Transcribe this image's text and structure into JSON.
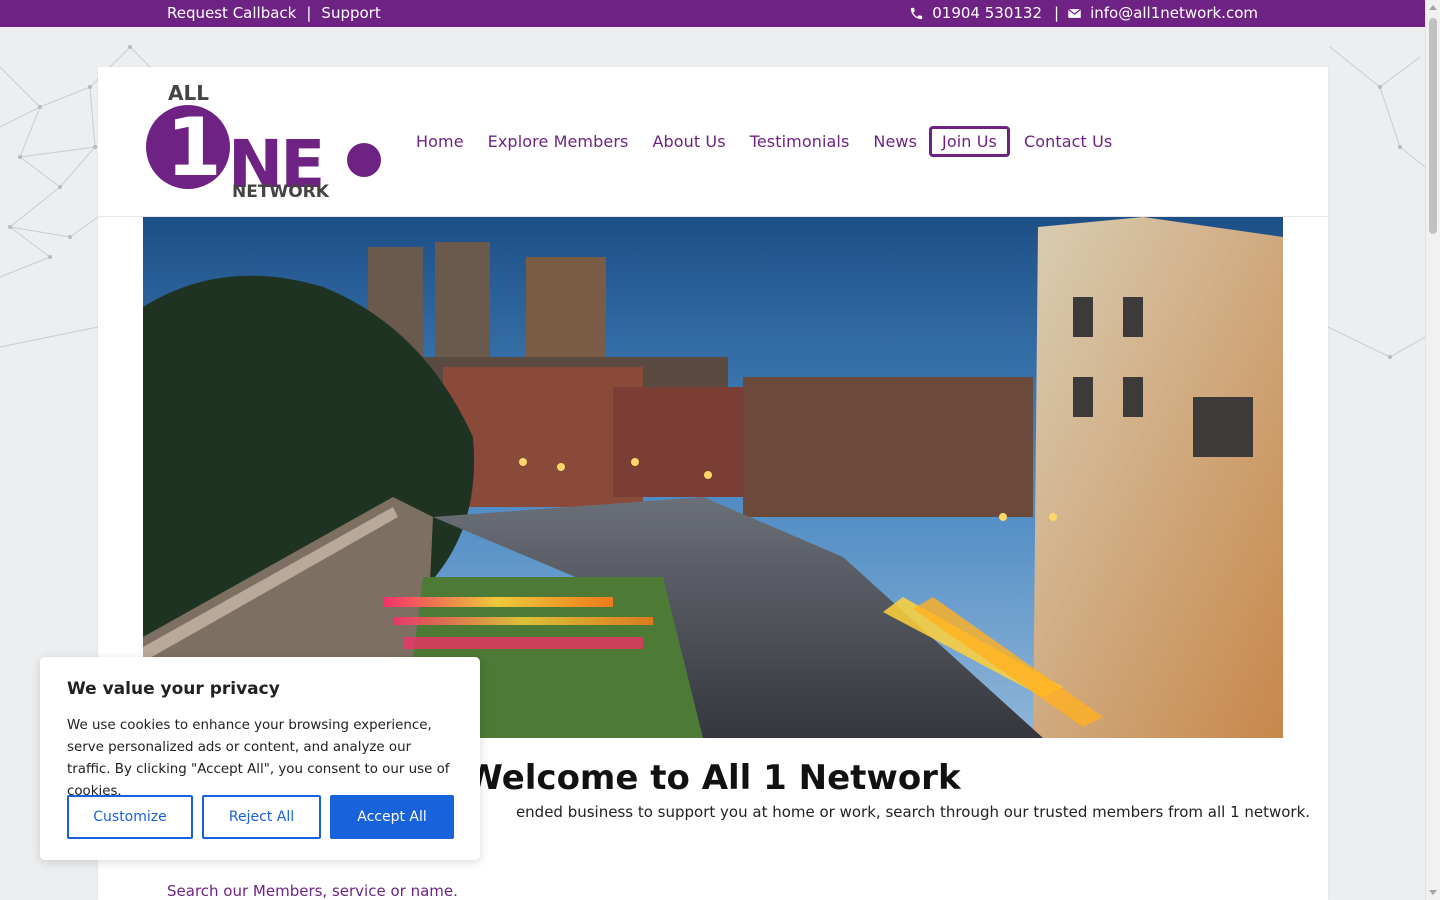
{
  "topbar": {
    "request_callback": "Request Callback",
    "separator": "|",
    "support": "Support",
    "phone": "01904 530132",
    "email_separator": "|",
    "email": "info@all1network.com"
  },
  "logo": {
    "line1": "ALL",
    "numeral": "1",
    "letters": "NE",
    "line3": "NETWORK"
  },
  "nav": {
    "items": [
      "Home",
      "Explore Members",
      "About Us",
      "Testimonials",
      "News",
      "Join Us",
      "Contact Us"
    ]
  },
  "main": {
    "title": "Welcome to All 1 Network",
    "intro": "ended business to support you at home or work, search through our trusted members from all 1 network.",
    "search_label": "Search our Members, service or name."
  },
  "cookie": {
    "title": "We value your privacy",
    "body": "We use cookies to enhance your browsing experience, serve personalized ads or content, and analyze our traffic. By clicking \"Accept All\", you consent to our use of cookies.",
    "customize": "Customize",
    "reject": "Reject All",
    "accept": "Accept All"
  },
  "colors": {
    "brand_purple": "#6e2384",
    "accent_blue": "#1863dc"
  },
  "icons": [
    "phone-icon",
    "envelope-icon"
  ]
}
